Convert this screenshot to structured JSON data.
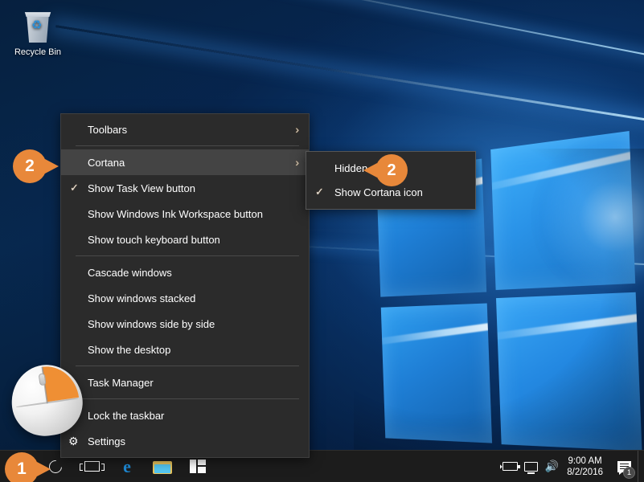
{
  "desktop": {
    "icons": [
      {
        "label": "Recycle Bin",
        "icon": "recycle-bin-icon"
      }
    ]
  },
  "context_menu": {
    "items": [
      {
        "label": "Toolbars",
        "has_submenu": true,
        "checked": false,
        "icon": null
      },
      {
        "label": "Cortana",
        "has_submenu": true,
        "checked": false,
        "icon": null,
        "selected": true
      },
      {
        "label": "Show Task View button",
        "has_submenu": false,
        "checked": true,
        "icon": null
      },
      {
        "label": "Show Windows Ink Workspace button",
        "has_submenu": false,
        "checked": false,
        "icon": null
      },
      {
        "label": "Show touch keyboard button",
        "has_submenu": false,
        "checked": false,
        "icon": null
      },
      {
        "label": "Cascade windows",
        "has_submenu": false,
        "checked": false,
        "icon": null
      },
      {
        "label": "Show windows stacked",
        "has_submenu": false,
        "checked": false,
        "icon": null
      },
      {
        "label": "Show windows side by side",
        "has_submenu": false,
        "checked": false,
        "icon": null
      },
      {
        "label": "Show the desktop",
        "has_submenu": false,
        "checked": false,
        "icon": null
      },
      {
        "label": "Task Manager",
        "has_submenu": false,
        "checked": false,
        "icon": null
      },
      {
        "label": "Lock the taskbar",
        "has_submenu": false,
        "checked": false,
        "icon": null
      },
      {
        "label": "Settings",
        "has_submenu": false,
        "checked": false,
        "icon": "gear-icon"
      }
    ],
    "checkmark_glyph": "✓",
    "submenu_arrow_glyph": "›",
    "gear_glyph": "⚙"
  },
  "cortana_submenu": {
    "items": [
      {
        "label": "Hidden",
        "checked": false
      },
      {
        "label": "Show Cortana icon",
        "checked": true
      }
    ]
  },
  "taskbar": {
    "start_button": "Start",
    "cortana_button": "Cortana",
    "task_view_button": "Task View",
    "apps": [
      {
        "label": "Microsoft Edge",
        "icon": "edge-icon"
      },
      {
        "label": "File Explorer",
        "icon": "file-explorer-icon"
      },
      {
        "label": "Microsoft Store",
        "icon": "store-icon"
      }
    ],
    "tray": {
      "battery": "battery-icon",
      "network": "network-icon",
      "volume": "volume-icon",
      "volume_glyph": "🔊",
      "time": "9:00 AM",
      "date": "8/2/2016",
      "action_center": "Action Center",
      "notification_count": "1"
    },
    "show_desktop_button": "Show desktop"
  },
  "callouts": [
    {
      "number": "2",
      "target": "cortana-menu-item"
    },
    {
      "number": "2",
      "target": "hidden-submenu-item"
    },
    {
      "number": "1",
      "target": "taskbar-right-click"
    }
  ],
  "colors": {
    "accent_orange": "#e8883a",
    "menu_background": "#2b2b2b",
    "menu_highlight": "#444444",
    "taskbar_background": "#1c1c1c",
    "text": "#ffffff"
  }
}
